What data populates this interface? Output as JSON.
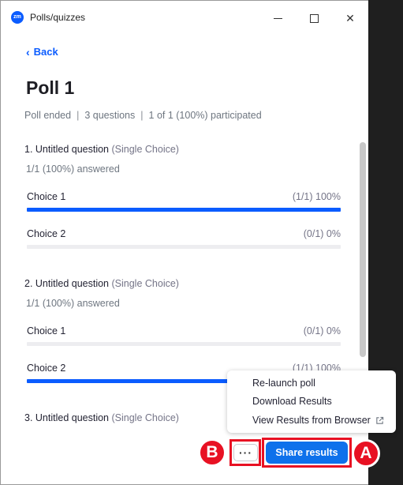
{
  "window": {
    "title": "Polls/quizzes",
    "app_icon_text": "zm",
    "close_glyph": "✕"
  },
  "nav": {
    "back_label": "Back",
    "back_glyph": "‹"
  },
  "poll": {
    "title": "Poll 1",
    "status": "Poll ended",
    "questions_count": "3 questions",
    "participation": "1 of 1 (100%) participated",
    "separator": "|"
  },
  "questions": [
    {
      "title": "1. Untitled question",
      "type": "(Single Choice)",
      "answered": "1/1 (100%) answered",
      "choices": [
        {
          "label": "Choice 1",
          "stat": "(1/1) 100%",
          "fraction": 1.0
        },
        {
          "label": "Choice 2",
          "stat": "(0/1) 0%",
          "fraction": 0.0
        }
      ]
    },
    {
      "title": "2. Untitled question",
      "type": "(Single Choice)",
      "answered": "1/1 (100%) answered",
      "choices": [
        {
          "label": "Choice 1",
          "stat": "(0/1) 0%",
          "fraction": 0.0
        },
        {
          "label": "Choice 2",
          "stat": "(1/1) 100%",
          "fraction": 1.0
        }
      ]
    },
    {
      "title": "3. Untitled question",
      "type": "(Single Choice)"
    }
  ],
  "menu": {
    "relaunch": "Re-launch poll",
    "download": "Download Results",
    "view_browser": "View Results from Browser"
  },
  "footer": {
    "more_glyph": "···",
    "share_label": "Share results"
  },
  "callouts": {
    "a": "A",
    "b": "B"
  },
  "colors": {
    "accent": "#0e71eb",
    "bar": "#0b5cff",
    "highlight": "#e81123"
  }
}
